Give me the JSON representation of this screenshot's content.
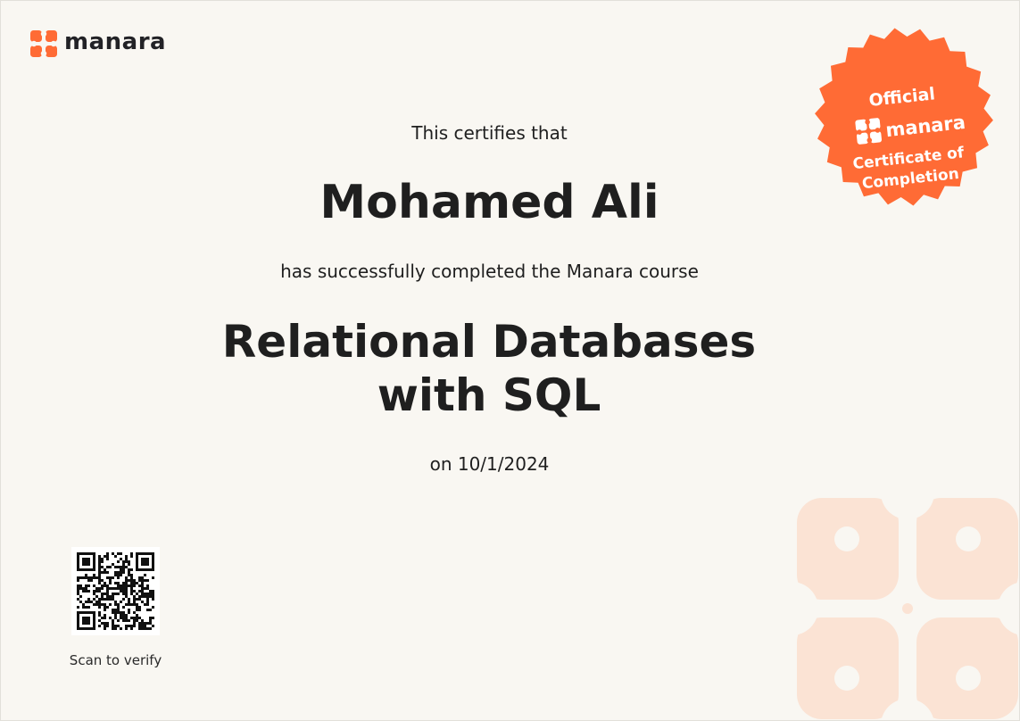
{
  "brand": {
    "logo_text": "manara",
    "accent_color": "#ff6b35",
    "light_accent_color": "#fbe3d4"
  },
  "certificate": {
    "intro": "This certifies that",
    "recipient_name": "Mohamed Ali",
    "completion_text": "has successfully completed the Manara course",
    "course_title": "Relational Databases with SQL",
    "date_text": "on 10/1/2024"
  },
  "badge": {
    "line1": "Official",
    "brand": "manara",
    "line3": "Certificate of",
    "line4": "Completion"
  },
  "verification": {
    "label": "Scan to verify"
  }
}
